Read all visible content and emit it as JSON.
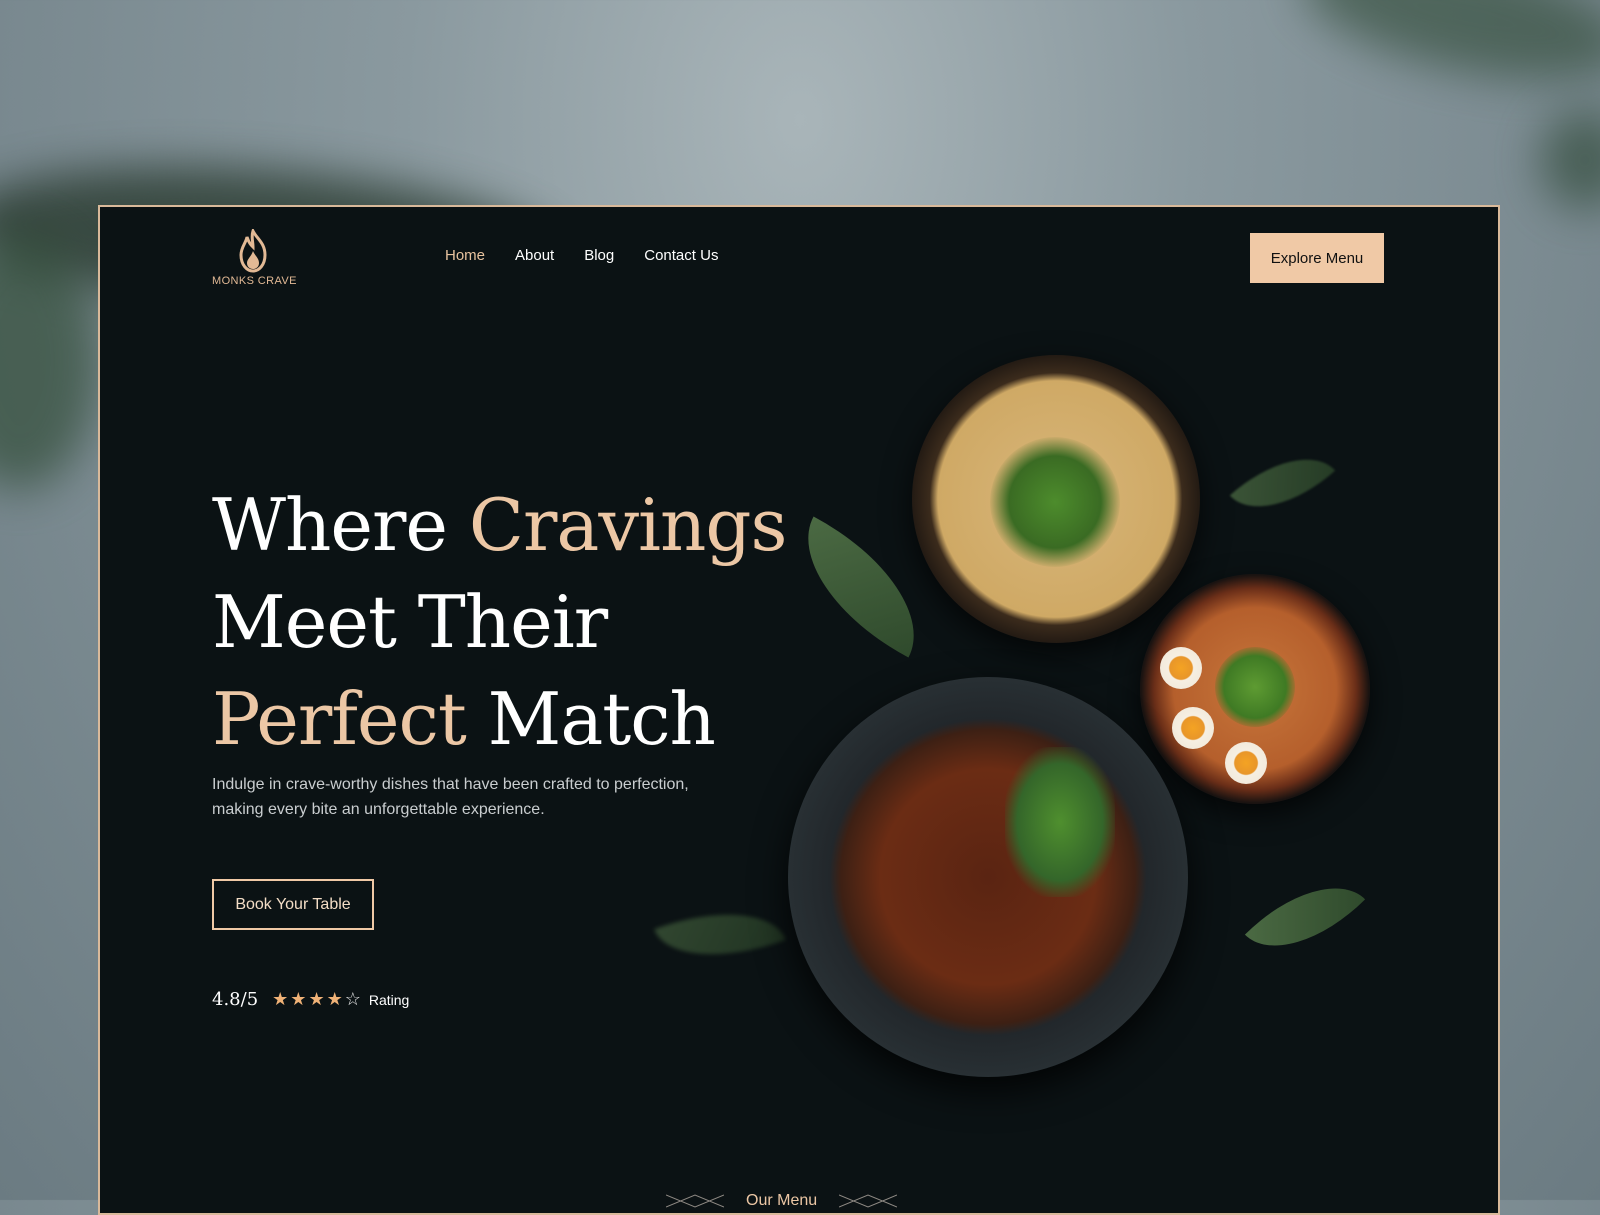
{
  "brand": {
    "name": "MONKS CRAVE",
    "logo_icon": "flame-icon",
    "accent_color": "#ecc7a5"
  },
  "nav": {
    "items": [
      {
        "label": "Home",
        "active": true
      },
      {
        "label": "About",
        "active": false
      },
      {
        "label": "Blog",
        "active": false
      },
      {
        "label": "Contact Us",
        "active": false
      }
    ]
  },
  "header": {
    "cta_label": "Explore Menu"
  },
  "hero": {
    "headline": {
      "line1_white": "Where ",
      "line1_accent": "Cravings",
      "line2_white": "Meet Their",
      "line3_accent": "Perfect",
      "line3_white": " Match"
    },
    "subtext": "Indulge in crave-worthy dishes that have been crafted to perfection, making every bite an unforgettable experience.",
    "book_label": "Book Your Table",
    "rating": {
      "score": "4.8/5",
      "stars_filled": 4,
      "stars_total": 5,
      "label": "Rating"
    }
  },
  "section": {
    "our_menu_label": "Our Menu"
  }
}
